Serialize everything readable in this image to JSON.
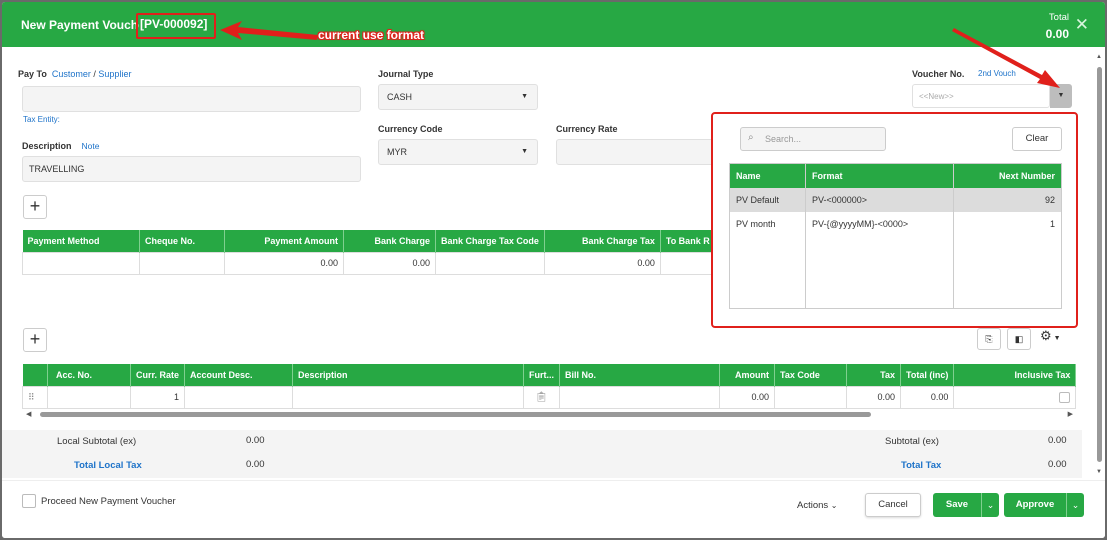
{
  "header": {
    "title": "New Payment Vouche",
    "voucher_code": "[PV-000092]",
    "total_label": "Total",
    "total_value": "0.00"
  },
  "annotation": {
    "text": "current use format",
    "color": "#e0201b"
  },
  "form": {
    "pay_to_label": "Pay To",
    "customer_link": "Customer",
    "sep": "/",
    "supplier_link": "Supplier",
    "tax_entity": "Tax Entity:",
    "description_label": "Description",
    "note_link": "Note",
    "description_value": "TRAVELLING",
    "journal_type_label": "Journal Type",
    "journal_type_value": "CASH",
    "currency_code_label": "Currency Code",
    "currency_code_value": "MYR",
    "currency_rate_label": "Currency Rate",
    "voucher_no_label": "Voucher No.",
    "second_voucher_link": "2nd Vouch",
    "voucher_no_placeholder": "<<New>>"
  },
  "payment_grid": {
    "columns": [
      "Payment Method",
      "Cheque No.",
      "Payment Amount",
      "Bank Charge",
      "Bank Charge Tax Code",
      "Bank Charge Tax",
      "To Bank R"
    ],
    "row": [
      "",
      "",
      "0.00",
      "0.00",
      "",
      "0.00",
      ""
    ]
  },
  "detail_grid": {
    "columns": [
      "",
      "Acc. No.",
      "Curr. Rate",
      "Account Desc.",
      "Description",
      "Furt...",
      "Bill No.",
      "Amount",
      "Tax Code",
      "Tax",
      "Total (inc)",
      "Inclusive Tax"
    ],
    "row": [
      "⠿",
      "",
      "1",
      "",
      "",
      "",
      "",
      "0.00",
      "",
      "0.00",
      "0.00",
      ""
    ]
  },
  "totals": {
    "local_subtotal_label": "Local Subtotal (ex)",
    "local_subtotal_value": "0.00",
    "total_local_tax_label": "Total Local Tax",
    "total_local_tax_value": "0.00",
    "subtotal_label": "Subtotal (ex)",
    "subtotal_value": "0.00",
    "total_tax_label": "Total Tax",
    "total_tax_value": "0.00"
  },
  "footer": {
    "proceed_label": "Proceed New Payment Voucher",
    "actions_label": "Actions",
    "cancel_label": "Cancel",
    "save_label": "Save",
    "approve_label": "Approve"
  },
  "voucher_popup": {
    "search_placeholder": "Search...",
    "clear_label": "Clear",
    "columns": [
      "Name",
      "Format",
      "Next Number"
    ],
    "rows": [
      {
        "name": "PV Default",
        "format": "PV-<000000>",
        "next": "92"
      },
      {
        "name": "PV month",
        "format": "PV-{@yyyyMM}-<0000>",
        "next": "1"
      }
    ]
  },
  "colors": {
    "brand_green": "#27a844",
    "link_blue": "#1e73c9",
    "highlight_red": "#e0201b"
  }
}
